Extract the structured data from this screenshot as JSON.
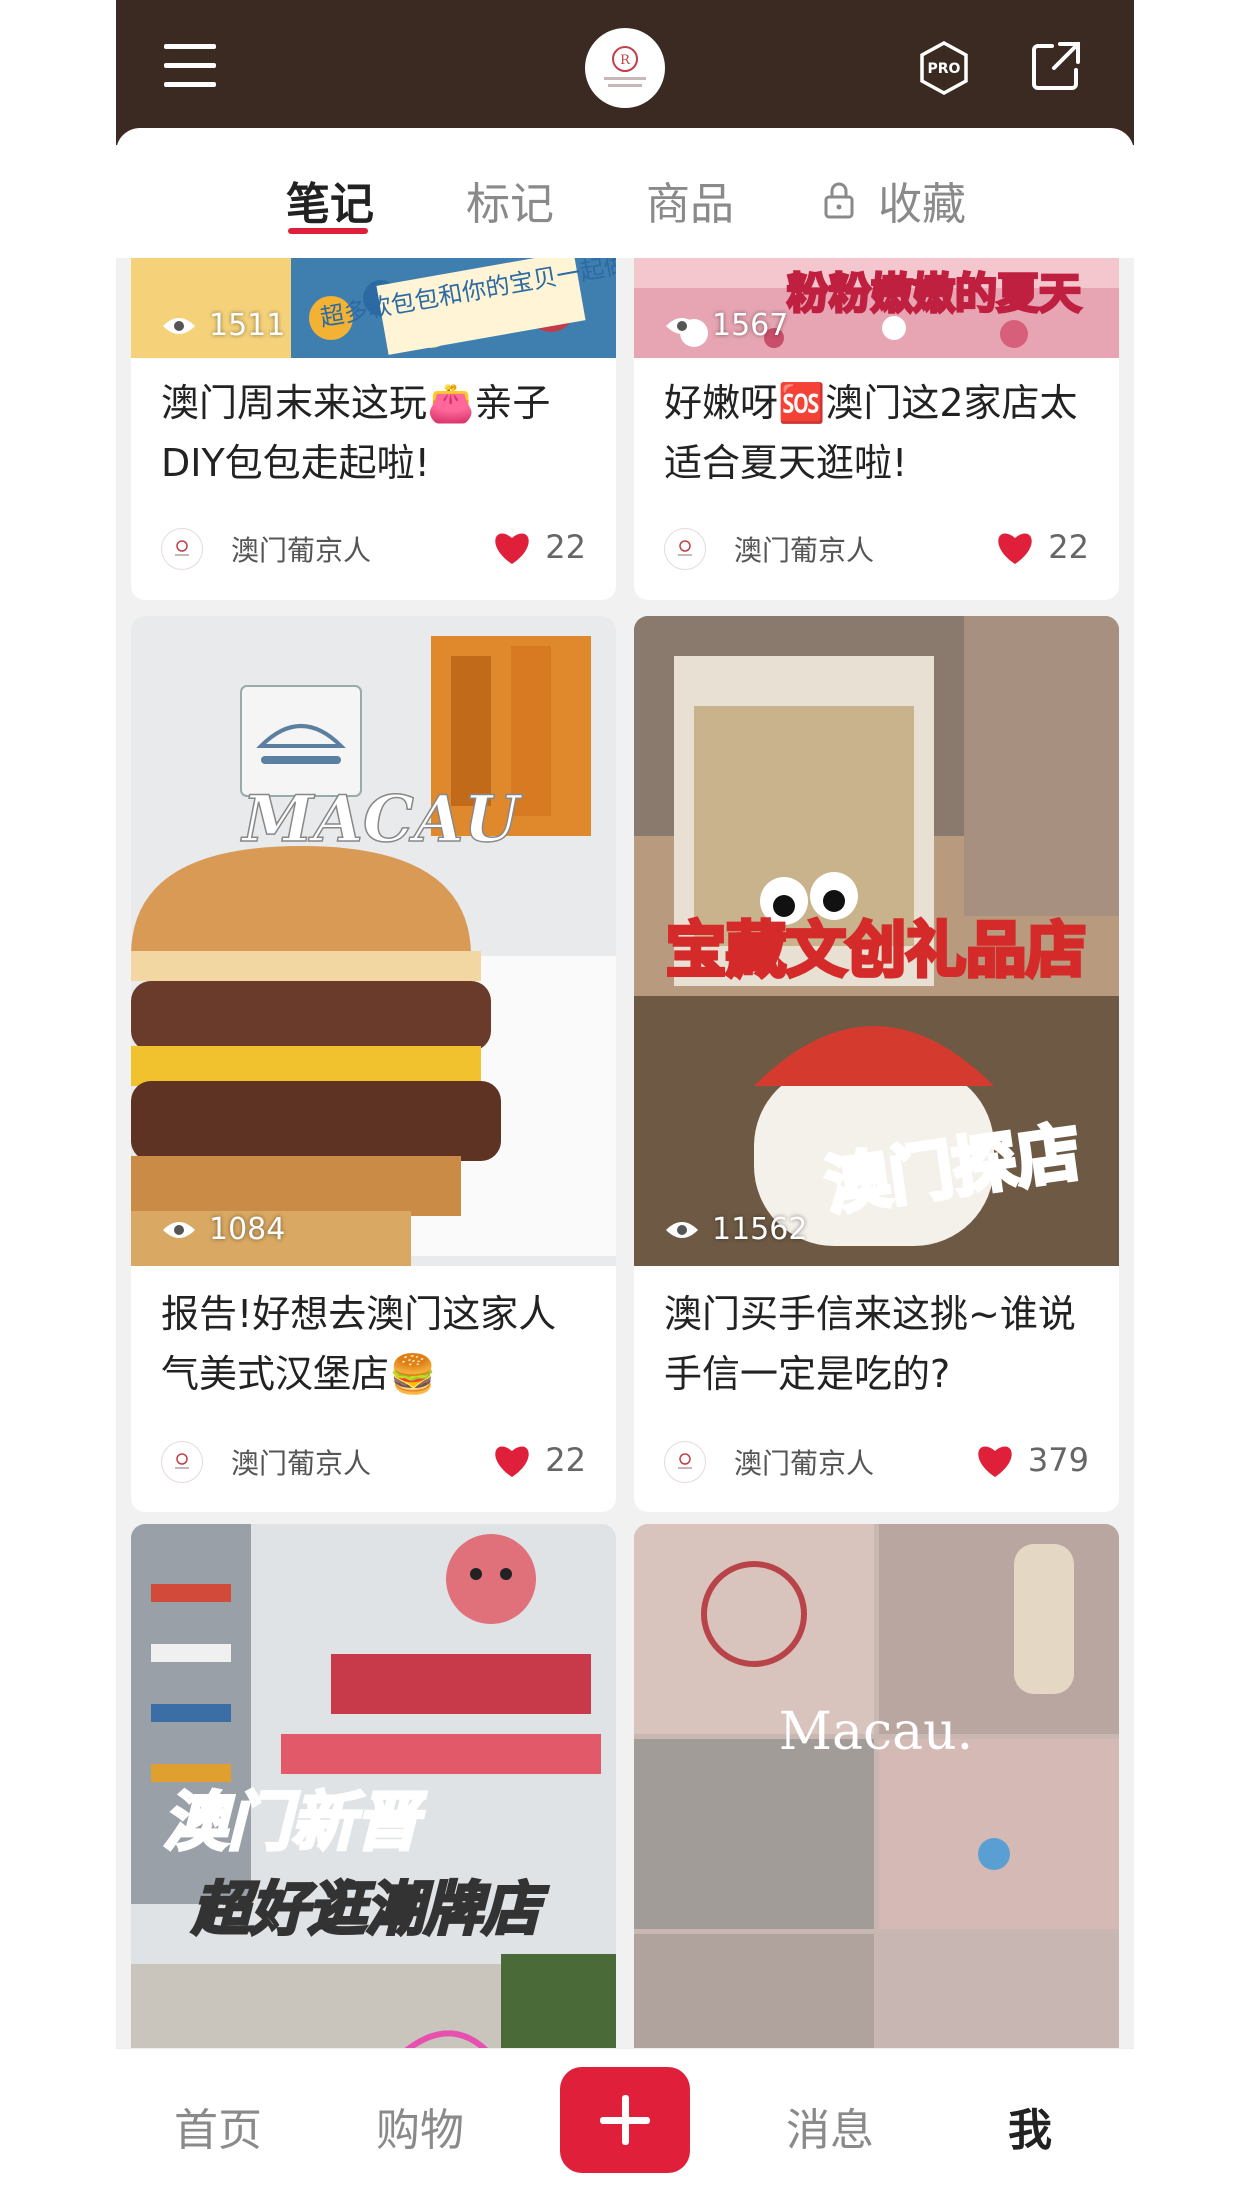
{
  "app": {
    "logo_text": "澳门葡京人"
  },
  "tabs": [
    {
      "label": "笔记",
      "active": true
    },
    {
      "label": "标记",
      "active": false
    },
    {
      "label": "商品",
      "active": false
    },
    {
      "label": "收藏",
      "active": false,
      "locked": true
    }
  ],
  "posts": [
    {
      "title": "澳门周末来这玩👛亲子DIY包包走起啦!",
      "views": "1511",
      "author": "澳门葡京人",
      "likes": "22",
      "overlay_text": "超多软包包和你的宝贝一起做!"
    },
    {
      "title": "好嫩呀🆘澳门这2家店太适合夏天逛啦!",
      "views": "1567",
      "author": "澳门葡京人",
      "likes": "22",
      "overlay_text": "粉粉嫩嫩的夏天"
    },
    {
      "title": "报告!好想去澳门这家人气美式汉堡店🍔",
      "views": "1084",
      "author": "澳门葡京人",
      "likes": "22",
      "overlay_text": "MACAU"
    },
    {
      "title": "澳门买手信来这挑~谁说手信一定是吃的?",
      "views": "11562",
      "author": "澳门葡京人",
      "likes": "379",
      "overlay_text": "宝藏文创礼品店",
      "overlay_text_2": "澳门探店"
    },
    {
      "overlay_text": "澳门新晋",
      "overlay_text_2": "超好逛潮牌店"
    },
    {
      "overlay_text": "Macau."
    }
  ],
  "bottom_nav": {
    "home": "首页",
    "shop": "购物",
    "messages": "消息",
    "me": "我"
  },
  "colors": {
    "accent": "#e0203a",
    "topbar": "#3a2a22"
  }
}
